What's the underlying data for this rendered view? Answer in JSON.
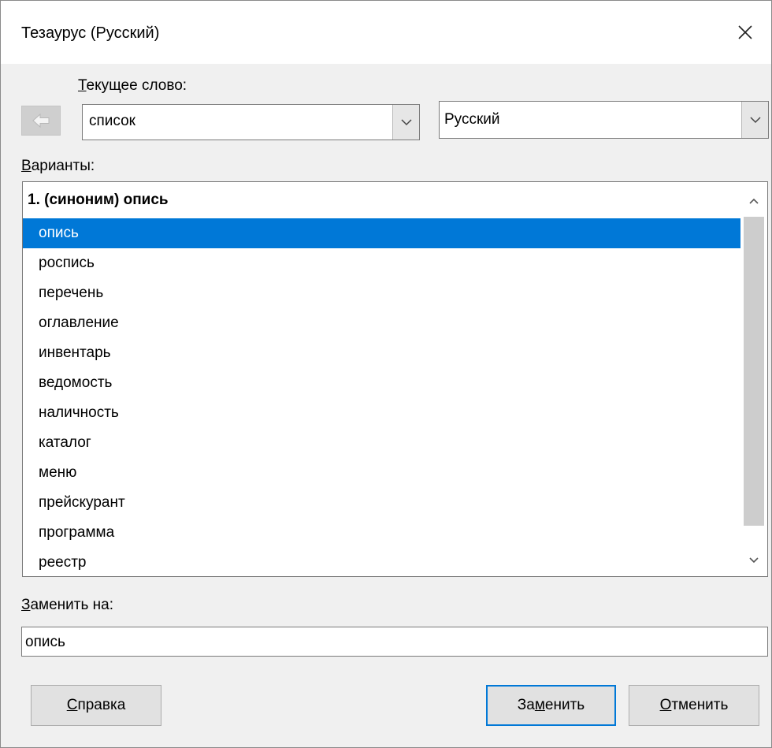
{
  "window": {
    "title": "Тезаурус (Русский)"
  },
  "labels": {
    "current_word_underlined": "Т",
    "current_word_rest": "екущее слово:",
    "variants_underlined": "В",
    "variants_rest": "арианты:",
    "replace_underlined": "З",
    "replace_rest": "аменить на:"
  },
  "current_word": {
    "value": "список"
  },
  "language": {
    "value": "Русский"
  },
  "variants": {
    "header": "1. (синоним) опись",
    "items": [
      "опись",
      "роспись",
      "перечень",
      "оглавление",
      "инвентарь",
      "ведомость",
      "наличность",
      "каталог",
      "меню",
      "прейскурант",
      "программа",
      "реестр"
    ],
    "selected": "опись"
  },
  "replace_with": {
    "value": "опись"
  },
  "buttons": {
    "help_underlined": "С",
    "help_rest": "правка",
    "replace_pre": "За",
    "replace_underlined": "м",
    "replace_post": "енить",
    "cancel_underlined": "О",
    "cancel_rest": "тменить"
  },
  "icons": {
    "back": "arrow-left-icon",
    "close": "close-icon",
    "dropdown": "chevron-down-icon",
    "scroll_up": "chevron-up-icon",
    "scroll_down": "chevron-down-icon"
  },
  "colors": {
    "selection": "#0078d7",
    "default_button_border": "#0078d7"
  }
}
